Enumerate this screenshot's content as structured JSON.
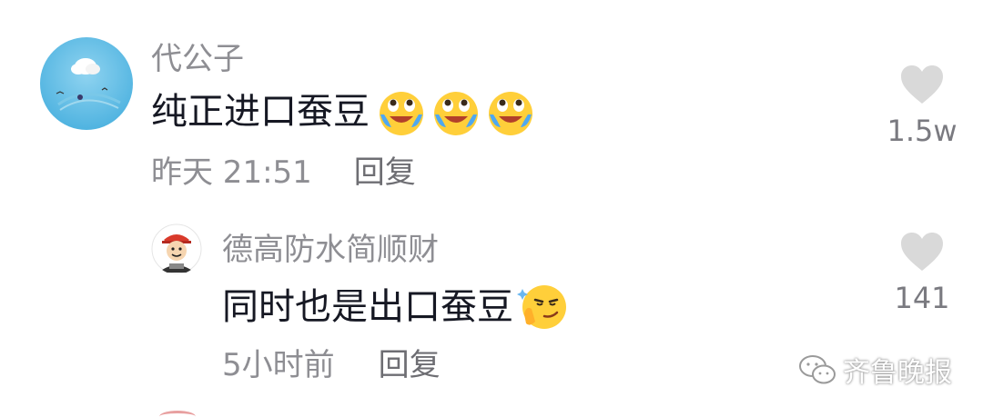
{
  "comments": [
    {
      "username": "代公子",
      "text": "纯正进口蚕豆",
      "emojis": [
        "laugh-cry-emoji",
        "laugh-cry-emoji",
        "laugh-cry-emoji"
      ],
      "time": "昨天 21:51",
      "reply_label": "回复",
      "likes": "1.5w"
    },
    {
      "username": "德高防水简顺财",
      "text": "同时也是出口蚕豆",
      "emojis": [
        "smirk-thinking-emoji"
      ],
      "time": "5小时前",
      "reply_label": "回复",
      "likes": "141"
    }
  ],
  "watermark": {
    "text": "齐鲁晚报",
    "icon": "wechat-icon"
  },
  "colors": {
    "username": "#8e8e93",
    "text": "#161823",
    "heart": "#d9d9d9"
  }
}
